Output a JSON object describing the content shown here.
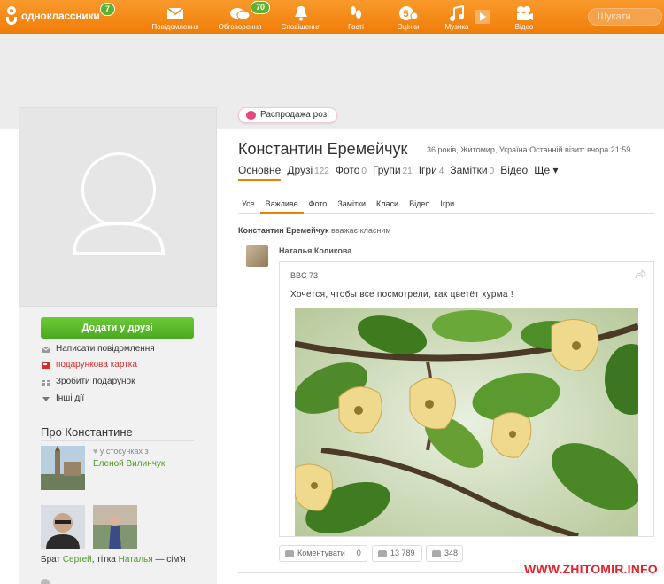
{
  "header": {
    "logo_text": "одноклассники",
    "logo_badge": "7",
    "nav": [
      {
        "label": "Повідомлення",
        "icon": "envelope-icon",
        "badge": ""
      },
      {
        "label": "Обговорення",
        "icon": "chat-bubbles-icon",
        "badge": "70"
      },
      {
        "label": "Сповіщення",
        "icon": "bell-icon",
        "badge": ""
      },
      {
        "label": "Гості",
        "icon": "footprints-icon",
        "badge": ""
      },
      {
        "label": "Оцінки",
        "icon": "rating-five-icon",
        "badge": ""
      },
      {
        "label": "Музика",
        "icon": "music-note-icon",
        "badge": ""
      },
      {
        "label": "Відео",
        "icon": "video-camera-icon",
        "badge": ""
      }
    ],
    "search_placeholder": "Шукати"
  },
  "profile": {
    "sale_badge": "Распродажа роз!",
    "name": "Константин Еремейчук",
    "meta": "36 років, Житомир, Україна  Останній візит: вчора 21:59",
    "tabs": [
      {
        "label": "Основне",
        "count": "",
        "active": true
      },
      {
        "label": "Друзі",
        "count": "122",
        "active": false
      },
      {
        "label": "Фото",
        "count": "0",
        "active": false
      },
      {
        "label": "Групи",
        "count": "21",
        "active": false
      },
      {
        "label": "Ігри",
        "count": "4",
        "active": false
      },
      {
        "label": "Замітки",
        "count": "0",
        "active": false
      },
      {
        "label": "Відео",
        "count": "",
        "active": false
      },
      {
        "label": "Ще ▾",
        "count": "",
        "active": false
      }
    ],
    "subtabs": [
      {
        "label": "Усе",
        "active": false
      },
      {
        "label": "Важливе",
        "active": true
      },
      {
        "label": "Фото",
        "active": false
      },
      {
        "label": "Замітки",
        "active": false
      },
      {
        "label": "Класи",
        "active": false
      },
      {
        "label": "Відео",
        "active": false
      },
      {
        "label": "Ігри",
        "active": false
      }
    ]
  },
  "sidebar": {
    "add_friend": "Додати у друзі",
    "actions": [
      {
        "label": "Написати повідомлення",
        "icon": "envelope-icon",
        "red": false
      },
      {
        "label": "подарункова картка",
        "icon": "gift-card-icon",
        "red": true
      },
      {
        "label": "Зробити подарунок",
        "icon": "gift-icon",
        "red": false
      },
      {
        "label": "Інші дії",
        "icon": "triangle-down-icon",
        "red": false
      }
    ],
    "about_title": "Про Константине",
    "relationship_prefix": "у стосунках з",
    "relationship_name": "Еленой Вилинчук",
    "family_prefix": "Брат ",
    "family_name1": "Сергей",
    "family_mid": ", тітка ",
    "family_name2": "Наталья",
    "family_suffix": " — сім'я"
  },
  "feed": {
    "head_name": "Константин Еремейчук",
    "head_action": " вважає класним",
    "author": "Наталья Коликова",
    "group": "BBC 73",
    "text": "Хочется, чтобы все посмотрели, как цветёт хурма !",
    "comment_label": "Коментувати",
    "comment_count": "0",
    "share_count": "13 789",
    "like_count": "348"
  },
  "watermark": "WWW.ZHITOMIR.INFO",
  "colors": {
    "orange": "#f07d07",
    "green": "#5fb22d",
    "link": "#4e9c2a",
    "red": "#e0242c"
  }
}
